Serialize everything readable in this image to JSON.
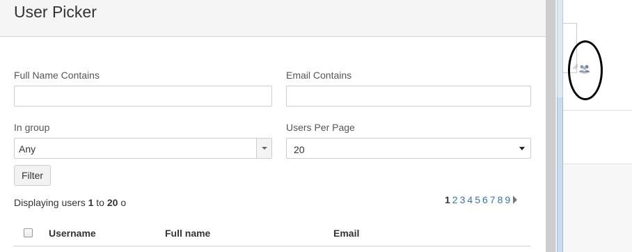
{
  "dialog": {
    "title": "User Picker",
    "full_name_label": "Full Name Contains",
    "full_name_value": "",
    "email_label": "Email Contains",
    "email_value": "",
    "group_label": "In group",
    "group_value": "Any",
    "per_page_label": "Users Per Page",
    "per_page_value": "20",
    "filter_button": "Filter",
    "status": {
      "prefix": "Displaying users ",
      "from": "1",
      "to_word": " to ",
      "to": "20",
      "suffix": " o"
    },
    "pagination": {
      "current": "1",
      "pages": [
        "2",
        "3",
        "4",
        "5",
        "6",
        "7",
        "8",
        "9"
      ]
    },
    "table": {
      "columns": [
        "Username",
        "Full name",
        "Email"
      ]
    }
  },
  "background": {
    "icon": "group-icon",
    "annotation": "black ellipse highlight"
  },
  "colors": {
    "link": "#3572b0",
    "header_bg": "#f5f5f5",
    "scrollbar": "#cdcdcd"
  }
}
